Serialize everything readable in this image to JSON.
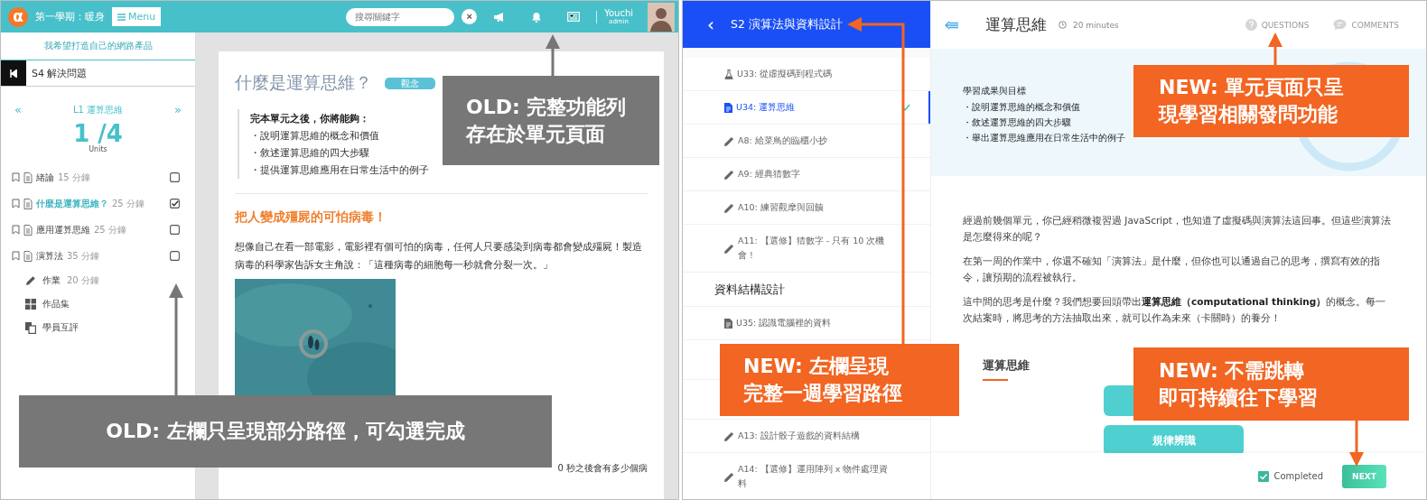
{
  "old_screen": {
    "top_bar": {
      "logo": "α",
      "course": "第一學期：暖身",
      "menu_button": "Menu",
      "search": {
        "placeholder": "搜尋關鍵字"
      },
      "clear": "×",
      "user": {
        "name": "Youchi",
        "role": "admin"
      }
    },
    "sidebar": {
      "project": "我希望打造自己的網路產品",
      "stage": "S4 解決問題",
      "lesson": {
        "prev": "«",
        "title": "L1 運算思維",
        "next": "»"
      },
      "progress": "1 /4",
      "progress_unit": "Units",
      "units": [
        {
          "title": "緒論",
          "duration": "15 分鐘",
          "selected": false,
          "checked": false
        },
        {
          "title": "什麼是運算思維？",
          "duration": "25 分鐘",
          "selected": true,
          "checked": true
        },
        {
          "title": "應用運算思維",
          "duration": "25 分鐘",
          "selected": false,
          "checked": false
        },
        {
          "title": "演算法",
          "duration": "35 分鐘",
          "selected": false,
          "checked": false
        }
      ],
      "extras": [
        {
          "kind": "pencil",
          "title": "作業",
          "duration": "20 分鐘"
        },
        {
          "kind": "grid",
          "title": "作品集"
        },
        {
          "kind": "copy",
          "title": "學員互評"
        }
      ]
    },
    "article": {
      "title": "什麼是運算思維？",
      "tag": "觀念",
      "objectives_heading": "完本單元之後，你將能夠：",
      "objectives": [
        "・說明運算思維的概念和價值",
        "・敘述運算思維的四大步驟",
        "・提供運算思維應用在日常生活中的例子"
      ],
      "section_heading": "把人變成殭屍的可怕病毒！",
      "paragraph": "想像自己在看一部電影，電影裡有個可怕的病毒，任何人只要感染到病毒都會變成殭屍！製造病毒的科學家告訴女主角說：「這種病毒的細胞每一秒就會分裂一次。」",
      "image": {
        "kind": "picture"
      },
      "partial_line": "0 秒之後會有多少個病"
    }
  },
  "new_screen": {
    "sidebar": {
      "back": "‹",
      "title": "S2 演算法與資料設計",
      "items": [
        {
          "kind": "lab",
          "label": "U33: 從虛擬碼到程式碼",
          "selected": false,
          "done": false
        },
        {
          "kind": "doc",
          "label": "U34: 運算思維",
          "selected": true,
          "done": true
        },
        {
          "kind": "pencil",
          "label": "A8: 給菜鳥的臨櫃小抄",
          "selected": false,
          "done": false
        },
        {
          "kind": "pencil",
          "label": "A9: 經典猜數字",
          "selected": false,
          "done": false
        },
        {
          "kind": "pencil",
          "label": "A10: 練習觀摩與回饋",
          "selected": false,
          "done": false
        },
        {
          "kind": "pencil",
          "label": "A11: 【選修】猜數字 - 只有 10 次機會！",
          "selected": false,
          "done": false
        },
        {
          "kind": "heading",
          "label": "資料結構設計"
        },
        {
          "kind": "doc",
          "label": "U35: 認識電腦裡的資料",
          "selected": false,
          "done": false
        },
        {
          "kind": "hidden"
        },
        {
          "kind": "hidden"
        },
        {
          "kind": "pencil",
          "label": "A13: 設計骰子遊戲的資料結構",
          "selected": false,
          "done": false
        },
        {
          "kind": "pencil",
          "label": "A14: 【選修】運用陣列 x 物件處理資料",
          "selected": false,
          "done": false
        }
      ]
    },
    "content": {
      "title": "運算思維",
      "duration": "20 minutes",
      "actions": [
        {
          "kind": "question",
          "label": "QUESTIONS"
        },
        {
          "kind": "comment",
          "label": "COMMENTS"
        }
      ],
      "objectives_heading": "學習成果與目標",
      "objectives": [
        "・說明運算思維的概念和價值",
        "・敘述運算思維的四大步驟",
        "・舉出運算思維應用在日常生活中的例子"
      ],
      "paragraphs": [
        "經過前幾個單元，你已經稍微複習過 JavaScript，也知道了虛擬碼與演算法這回事。但這些演算法是怎麼得來的呢？",
        "在第一周的作業中，你還不確知「演算法」是什麼，但你也可以通過自己的思考，撰寫有效的指令，讓預期的流程被執行。",
        "這中間的思考是什麼？我們想要回頭帶出**運算思維（computational thinking）**的概念。每一次結案時，將思考的方法抽取出來，就可以作為未來（卡關時）的養分！"
      ],
      "section_heading": "運算思維",
      "diagram": [
        "規律辨識"
      ],
      "completed": {
        "label": "Completed",
        "checked": true
      },
      "next_button": "NEXT"
    }
  },
  "annotations": [
    {
      "kind": "old",
      "lines": [
        "OLD: 完整功能列",
        "存在於單元頁面"
      ]
    },
    {
      "kind": "old",
      "lines": [
        "OLD: 左欄只呈現部分路徑，可勾選完成"
      ]
    },
    {
      "kind": "new",
      "lines": [
        "NEW: 左欄呈現",
        "完整一週學習路徑"
      ]
    },
    {
      "kind": "new",
      "lines": [
        "NEW: 單元頁面只呈",
        "現學習相關發問功能"
      ]
    },
    {
      "kind": "new",
      "lines": [
        "NEW: 不需跳轉",
        "即可持續往下學習"
      ]
    }
  ]
}
